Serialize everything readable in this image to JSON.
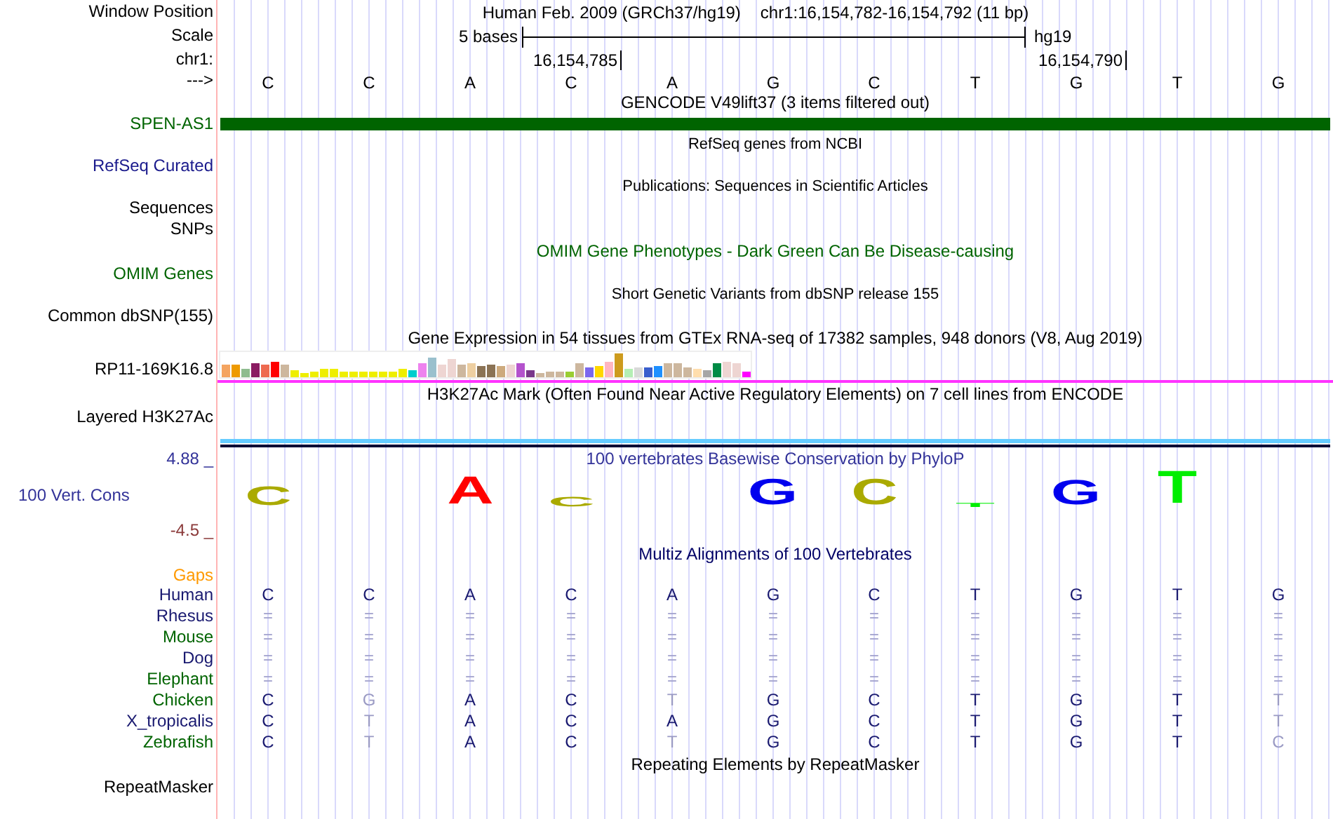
{
  "ruler": {
    "position_label": "Window Position",
    "assembly": "Human Feb. 2009 (GRCh37/hg19)",
    "range": "chr1:16,154,782-16,154,792 (11 bp)",
    "scale_label": "Scale",
    "scale_text": "5 bases",
    "scale_assembly": "hg19",
    "chrom_label": "chr1:",
    "strand_label": "--->"
  },
  "bases": [
    {
      "base": "C"
    },
    {
      "base": "C"
    },
    {
      "base": "A"
    },
    {
      "base": "C",
      "tick": "16,154,785"
    },
    {
      "base": "A"
    },
    {
      "base": "G"
    },
    {
      "base": "C"
    },
    {
      "base": "T"
    },
    {
      "base": "G",
      "tick": "16,154,790"
    },
    {
      "base": "T"
    },
    {
      "base": "G"
    }
  ],
  "tracks": [
    {
      "kind": "gene",
      "title": {
        "text": "GENCODE V49lift37 (3 items filtered out)",
        "color": "#000000",
        "kind": "normal"
      },
      "labels": [
        {
          "text": "SPEN-AS1",
          "color": "#006400"
        }
      ]
    },
    {
      "kind": "plain",
      "title": {
        "text": "RefSeq genes from NCBI",
        "color": "#000000",
        "kind": "small"
      },
      "labels": [
        {
          "text": "RefSeq Curated",
          "color": "#1a1a8c"
        }
      ]
    },
    {
      "kind": "plain",
      "title": {
        "text": "Publications: Sequences in Scientific Articles",
        "color": "#000000",
        "kind": "small"
      },
      "labels": [
        {
          "text": "Sequences",
          "color": "#000000"
        },
        {
          "text": "SNPs",
          "color": "#000000"
        }
      ]
    },
    {
      "kind": "plain",
      "title": {
        "text": "OMIM Gene Phenotypes - Dark Green Can Be Disease-causing",
        "color": "#006400",
        "kind": "normal"
      },
      "labels": [
        {
          "text": "OMIM Genes",
          "color": "#006400"
        }
      ]
    },
    {
      "kind": "plain",
      "title": {
        "text": "Short Genetic Variants from dbSNP release 155",
        "color": "#000000",
        "kind": "small"
      },
      "labels": [
        {
          "text": "Common dbSNP(155)",
          "color": "#000000"
        }
      ]
    },
    {
      "kind": "expression",
      "title": {
        "text": "Gene Expression in 54 tissues from GTEx RNA-seq of 17382 samples, 948 donors (V8, Aug 2019)",
        "color": "#000000",
        "kind": "normal"
      },
      "labels": [
        {
          "text": "RP11-169K16.8",
          "color": "#000000"
        }
      ]
    },
    {
      "kind": "signal",
      "title": {
        "text": "H3K27Ac Mark (Often Found Near Active Regulatory Elements) on 7 cell lines from ENCODE",
        "color": "#000000",
        "kind": "normal"
      },
      "labels": [
        {
          "text": "Layered H3K27Ac",
          "color": "#000000"
        }
      ]
    },
    {
      "kind": "conservation",
      "title": {
        "text": "100 vertebrates Basewise Conservation by PhyloP",
        "color": "#333399",
        "kind": "normal"
      },
      "labels": [
        {
          "text": "4.88 _",
          "color": "#333399"
        },
        {
          "text": "100 Vert. Cons",
          "color": "#333399"
        },
        {
          "text": "-4.5 _",
          "color": "#8b3a3a"
        }
      ],
      "logo": [
        {
          "letter": "C",
          "color": "#aaaa00"
        },
        {
          "letter": "A",
          "color": "#ff0000"
        },
        {
          "letter": "C",
          "color": "#aaaa00"
        },
        {
          "letter": "G",
          "color": "#0000ee"
        },
        {
          "letter": "C",
          "color": "#aaaa00"
        },
        {
          "letter": "T",
          "color": "#00ee00"
        },
        {
          "letter": "G",
          "color": "#0000ee"
        },
        {
          "letter": "T",
          "color": "#00ee00"
        }
      ]
    },
    {
      "kind": "alignment",
      "title": {
        "text": "Multiz Alignments of 100 Vertebrates",
        "color": "#000066",
        "kind": "normal"
      },
      "labels": [
        {
          "text": "Gaps",
          "color": "#ff9900"
        }
      ],
      "species": [
        {
          "name": "Human",
          "color": "#191970",
          "kind": "bases",
          "cells": [
            {
              "b": "C",
              "differs": false
            },
            {
              "b": "C",
              "differs": false
            },
            {
              "b": "A",
              "differs": false
            },
            {
              "b": "C",
              "differs": false
            },
            {
              "b": "A",
              "differs": false
            },
            {
              "b": "G",
              "differs": false
            },
            {
              "b": "C",
              "differs": false
            },
            {
              "b": "T",
              "differs": false
            },
            {
              "b": "G",
              "differs": false
            },
            {
              "b": "T",
              "differs": false
            },
            {
              "b": "G",
              "differs": false
            }
          ]
        },
        {
          "name": "Rhesus",
          "color": "#191970",
          "kind": "match",
          "cells": [
            {
              "b": "="
            },
            {
              "b": "="
            },
            {
              "b": "="
            },
            {
              "b": "="
            },
            {
              "b": "="
            },
            {
              "b": "="
            },
            {
              "b": "="
            },
            {
              "b": "="
            },
            {
              "b": "="
            },
            {
              "b": "="
            },
            {
              "b": "="
            }
          ]
        },
        {
          "name": "Mouse",
          "color": "#006400",
          "kind": "match",
          "cells": [
            {
              "b": "="
            },
            {
              "b": "="
            },
            {
              "b": "="
            },
            {
              "b": "="
            },
            {
              "b": "="
            },
            {
              "b": "="
            },
            {
              "b": "="
            },
            {
              "b": "="
            },
            {
              "b": "="
            },
            {
              "b": "="
            },
            {
              "b": "="
            }
          ]
        },
        {
          "name": "Dog",
          "color": "#191970",
          "kind": "match",
          "cells": [
            {
              "b": "="
            },
            {
              "b": "="
            },
            {
              "b": "="
            },
            {
              "b": "="
            },
            {
              "b": "="
            },
            {
              "b": "="
            },
            {
              "b": "="
            },
            {
              "b": "="
            },
            {
              "b": "="
            },
            {
              "b": "="
            },
            {
              "b": "="
            }
          ]
        },
        {
          "name": "Elephant",
          "color": "#006400",
          "kind": "match",
          "cells": [
            {
              "b": "="
            },
            {
              "b": "="
            },
            {
              "b": "="
            },
            {
              "b": "="
            },
            {
              "b": "="
            },
            {
              "b": "="
            },
            {
              "b": "="
            },
            {
              "b": "="
            },
            {
              "b": "="
            },
            {
              "b": "="
            },
            {
              "b": "="
            }
          ]
        },
        {
          "name": "Chicken",
          "color": "#006400",
          "kind": "bases",
          "cells": [
            {
              "b": "C",
              "differs": false
            },
            {
              "b": "G",
              "differs": true
            },
            {
              "b": "A",
              "differs": false
            },
            {
              "b": "C",
              "differs": false
            },
            {
              "b": "T",
              "differs": true
            },
            {
              "b": "G",
              "differs": false
            },
            {
              "b": "C",
              "differs": false
            },
            {
              "b": "T",
              "differs": false
            },
            {
              "b": "G",
              "differs": false
            },
            {
              "b": "T",
              "differs": false
            },
            {
              "b": "T",
              "differs": true
            }
          ]
        },
        {
          "name": "X_tropicalis",
          "color": "#191970",
          "kind": "bases",
          "cells": [
            {
              "b": "C",
              "differs": false
            },
            {
              "b": "T",
              "differs": true
            },
            {
              "b": "A",
              "differs": false
            },
            {
              "b": "C",
              "differs": false
            },
            {
              "b": "A",
              "differs": false
            },
            {
              "b": "G",
              "differs": false
            },
            {
              "b": "C",
              "differs": false
            },
            {
              "b": "T",
              "differs": false
            },
            {
              "b": "G",
              "differs": false
            },
            {
              "b": "T",
              "differs": false
            },
            {
              "b": "T",
              "differs": true
            }
          ]
        },
        {
          "name": "Zebrafish",
          "color": "#006400",
          "kind": "bases",
          "cells": [
            {
              "b": "C",
              "differs": false
            },
            {
              "b": "T",
              "differs": true
            },
            {
              "b": "A",
              "differs": false
            },
            {
              "b": "C",
              "differs": false
            },
            {
              "b": "T",
              "differs": true
            },
            {
              "b": "G",
              "differs": false
            },
            {
              "b": "C",
              "differs": false
            },
            {
              "b": "T",
              "differs": false
            },
            {
              "b": "G",
              "differs": false
            },
            {
              "b": "T",
              "differs": false
            },
            {
              "b": "C",
              "differs": true
            }
          ]
        }
      ]
    },
    {
      "kind": "plain",
      "title": {
        "text": "Repeating Elements by RepeatMasker",
        "color": "#000000",
        "kind": "normal"
      },
      "labels": [
        {
          "text": "RepeatMasker",
          "color": "#000000"
        }
      ]
    }
  ]
}
